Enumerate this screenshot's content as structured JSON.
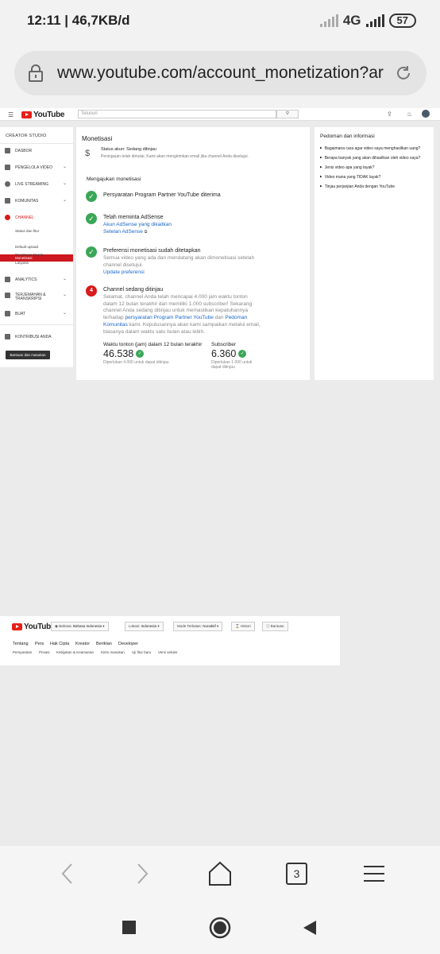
{
  "status_bar": {
    "time": "12:11",
    "speed": "| 46,7KB/d",
    "network": "4G",
    "battery": "57"
  },
  "browser": {
    "url": "www.youtube.com/account_monetization?ar",
    "tab_count": "3"
  },
  "header": {
    "logo_text": "YouTube",
    "search_placeholder": "Telusuri"
  },
  "sidebar": {
    "title": "CREATOR STUDIO",
    "items": [
      {
        "label": "DASBOR"
      },
      {
        "label": "PENGELOLA VIDEO"
      },
      {
        "label": "LIVE STREAMING"
      },
      {
        "label": "KOMUNITAS"
      },
      {
        "label": "CHANNEL"
      },
      {
        "label": "ANALYTICS"
      },
      {
        "label": "TERJEMAHAN & TRANSKRIPSI"
      },
      {
        "label": "BUAT"
      },
      {
        "label": "KONTRIBUSI ANDA"
      }
    ],
    "channel_sub": [
      "Status dan fitur",
      "Monetisasi",
      "Default upload",
      "Pencitraan Merek",
      "Lanjutan"
    ],
    "feedback": "Bantuan dan masukan"
  },
  "main": {
    "title": "Monetisasi",
    "status_title": "Status akun: Sedang ditinjau",
    "status_desc": "Peninjauan telah dimulai. Kami akan mengirimkan email jika channel Anda disetujui.",
    "apply_heading": "Mengajukan monetisasi",
    "step1": "Persyaratan Program Partner YouTube diterima",
    "step2_title": "Telah meminta AdSense",
    "step2_link1": "Akun AdSense yang dikaitkan",
    "step2_link2": "Setelan AdSense",
    "step3_title": "Preferensi monetisasi sudah ditetapkan",
    "step3_desc": "Semua video yang ada dan mendatang akan dimonetisasi setelah channel disetujui.",
    "step3_link": "Update preferensi",
    "step4_num": "4",
    "step4_title": "Channel sedang ditinjau",
    "step4_desc_a": "Selamat, channel Anda telah mencapai 4.000 jam waktu tonton dalam 12 bulan terakhir dan memiliki 1.000 subscriber! Sekarang channel Anda sedang ditinjau untuk memastikan kepatuhannya terhadap ",
    "step4_link_a": "persyaratan Program Partner YouTube",
    "step4_desc_b": " dan ",
    "step4_link_b": "Pedoman Komunitas",
    "step4_desc_c": " kami. Keputusannya akan kami sampaikan melalui email, biasanya dalam waktu satu bulan atau lebih.",
    "watch_label": "Waktu tonton (jam) dalam 12 bulan terakhir",
    "watch_value": "46.538",
    "watch_note": "Diperlukan 4.000 untuk dapat ditinjau",
    "subs_label": "Subscriber",
    "subs_value": "6.360",
    "subs_note": "Diperlukan 1.000 untuk dapat ditinjau"
  },
  "guide": {
    "title": "Pedoman dan informasi",
    "items": [
      "Bagaimana cara agar video saya menghasilkan uang?",
      "Berapa banyak yang akan dihasilkan oleh video saya?",
      "Jenis video apa yang layak?",
      "Video mana yang TIDAK layak?",
      "Tinjau perjanjian Anda dengan YouTube"
    ]
  },
  "footer": {
    "lang_label": "Bahasa:",
    "lang_value": "Bahasa Indonesia",
    "loc_label": "Lokasi:",
    "loc_value": "Indonesia",
    "mode_label": "Mode Terbatas:",
    "mode_value": "Nonaktif",
    "history": "Histori",
    "help": "Bantuan",
    "links": [
      "Tentang",
      "Pers",
      "Hak Cipta",
      "Kreator",
      "Beriklan",
      "Developer"
    ],
    "links2": [
      "Persyaratan",
      "Privasi",
      "Kebijakan & Keamanan",
      "Kirim masukan",
      "Uji fitur baru",
      "Versi seluler"
    ]
  },
  "colors": {
    "accent_red": "#cc181e",
    "check_green": "#3aa757",
    "link_blue": "#1a67c9"
  }
}
